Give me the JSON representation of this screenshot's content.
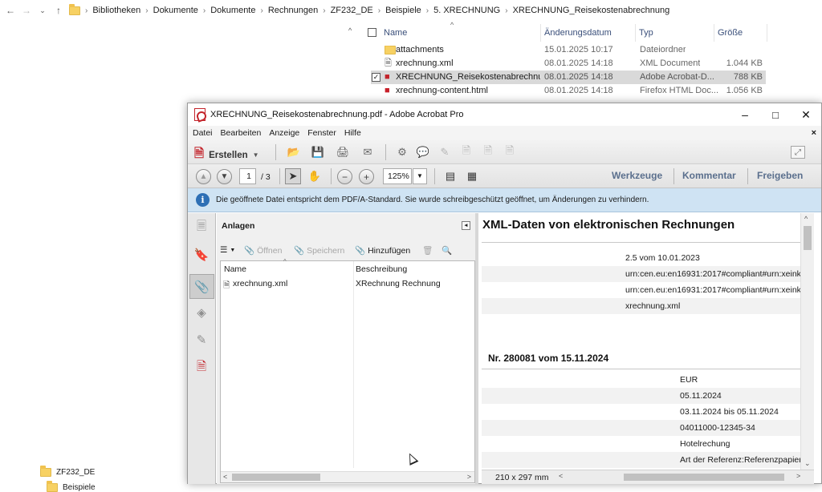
{
  "explorer": {
    "breadcrumbs": [
      "Bibliotheken",
      "Dokumente",
      "Dokumente",
      "Rechnungen",
      "ZF232_DE",
      "Beispiele",
      "5. XRECHNUNG",
      "XRECHNUNG_Reisekostenabrechnung"
    ],
    "columns": {
      "name": "Name",
      "date": "Änderungsdatum",
      "type": "Typ",
      "size": "Größe"
    },
    "files": [
      {
        "name": "attachments",
        "date": "15.01.2025 10:17",
        "type": "Dateiordner",
        "size": "",
        "icon": "folder-icon"
      },
      {
        "name": "xrechnung.xml",
        "date": "08.01.2025 14:18",
        "type": "XML Document",
        "size": "1.044 KB",
        "icon": "xml-file-icon"
      },
      {
        "name": "XRECHNUNG_Reisekostenabrechnung...",
        "date": "08.01.2025 14:18",
        "type": "Adobe Acrobat-D...",
        "size": "788 KB",
        "icon": "pdf-file-icon"
      },
      {
        "name": "xrechnung-content.html",
        "date": "08.01.2025 14:18",
        "type": "Firefox HTML Doc...",
        "size": "1.056 KB",
        "icon": "html-file-icon"
      }
    ],
    "tree": [
      "ZF232_DE",
      "Beispiele"
    ]
  },
  "acrobat": {
    "title": "XRECHNUNG_Reisekostenabrechnung.pdf - Adobe Acrobat Pro",
    "menu": [
      "Datei",
      "Bearbeiten",
      "Anzeige",
      "Fenster",
      "Hilfe"
    ],
    "create_label": "Erstellen",
    "page_current": "1",
    "page_total": "/ 3",
    "zoom": "125%",
    "right_links": [
      "Werkzeuge",
      "Kommentar",
      "Freigeben"
    ],
    "info_message": "Die geöffnete Datei entspricht dem PDF/A-Standard. Sie wurde schreibgeschützt geöffnet, um Änderungen zu verhindern.",
    "attachments": {
      "title": "Anlagen",
      "tools": [
        "Öffnen",
        "Speichern",
        "Hinzufügen"
      ],
      "col_name": "Name",
      "col_desc": "Beschreibung",
      "items": [
        {
          "name": "xrechnung.xml",
          "desc": "XRechnung Rechnung"
        }
      ]
    },
    "document": {
      "title": "XML-Daten von elektronischen Rechnungen",
      "meta_values": [
        "2.5 vom 10.01.2023",
        "urn:cen.eu:en16931:2017#compliant#urn:xeink",
        "urn:cen.eu:en16931:2017#compliant#urn:xeink",
        "xrechnung.xml"
      ],
      "invoice_heading": "Nr. 280081  vom  15.11.2024",
      "invoice_values": [
        "EUR",
        "05.11.2024",
        "03.11.2024 bis 05.11.2024",
        "04011000-12345-34",
        "Hotelrechung",
        "Art der Referenz:Referenzpapier"
      ]
    },
    "page_size": "210 x 297 mm"
  }
}
